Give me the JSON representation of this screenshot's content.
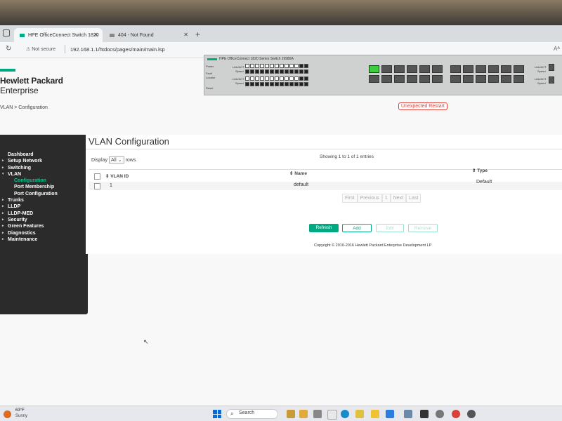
{
  "browser": {
    "tabs": [
      {
        "label": "HPE OfficeConnect Switch 1820",
        "active": true
      },
      {
        "label": "404 - Not Found",
        "active": false
      }
    ],
    "new_tab": "+",
    "security": "Not secure",
    "url": "192.168.1.1/htdocs/pages/main/main.lsp",
    "text_size": "Aᴬ"
  },
  "header": {
    "logo_line1": "Hewlett Packard",
    "logo_line2": "Enterprise",
    "breadcrumb": "VLAN > Configuration",
    "alert": "Unexpected Restart"
  },
  "switch_panel": {
    "model": "HPE OfficeConnect 1820 Series Switch J9980A",
    "labels": [
      "Power",
      "Fault",
      "Locator",
      "Reset",
      "Link/ACT",
      "Speed"
    ],
    "port_numbers_top": [
      "1",
      "3",
      "5",
      "7",
      "9",
      "11",
      "13",
      "15",
      "17",
      "19",
      "21",
      "23"
    ],
    "port_numbers_bottom": [
      "2",
      "4",
      "6",
      "8",
      "10",
      "12",
      "14",
      "16",
      "18",
      "20",
      "22",
      "24"
    ]
  },
  "sidebar": {
    "items": [
      {
        "label": "Dashboard",
        "arrow": false,
        "level": 0
      },
      {
        "label": "Setup Network",
        "arrow": true,
        "level": 0
      },
      {
        "label": "Switching",
        "arrow": true,
        "level": 0
      },
      {
        "label": "VLAN",
        "arrow": true,
        "level": 0,
        "expanded": true
      },
      {
        "label": "Configuration",
        "level": 1,
        "active": true
      },
      {
        "label": "Port Membership",
        "level": 1
      },
      {
        "label": "Port Configuration",
        "level": 1
      },
      {
        "label": "Trunks",
        "arrow": true,
        "level": 0
      },
      {
        "label": "LLDP",
        "arrow": true,
        "level": 0
      },
      {
        "label": "LLDP-MED",
        "arrow": true,
        "level": 0
      },
      {
        "label": "Security",
        "arrow": true,
        "level": 0
      },
      {
        "label": "Green Features",
        "arrow": true,
        "level": 0
      },
      {
        "label": "Diagnostics",
        "arrow": true,
        "level": 0
      },
      {
        "label": "Maintenance",
        "arrow": true,
        "level": 0
      }
    ]
  },
  "main": {
    "title": "VLAN Configuration",
    "display_label": "Display",
    "display_value": "All",
    "rows_label": "rows",
    "showing": "Showing 1 to 1 of 1 entries",
    "columns": [
      "⇕ VLAN ID",
      "⇕ Name",
      "⇕ Type"
    ],
    "rows": [
      {
        "vlan_id": "1",
        "name": "default",
        "type": "Default"
      }
    ],
    "pager": [
      "First",
      "Previous",
      "1",
      "Next",
      "Last"
    ],
    "buttons": {
      "refresh": "Refresh",
      "add": "Add",
      "edit": "Edit",
      "remove": "Remove"
    },
    "copyright": "Copyright © 2010-2016 Hewlett Packard Enterprise Development LP"
  },
  "taskbar": {
    "temp": "63°F",
    "weather": "Sunny",
    "search": "Search"
  },
  "colors": {
    "accent": "#01a982",
    "alert": "#e0433a",
    "sidebar": "#2b2b2b"
  }
}
